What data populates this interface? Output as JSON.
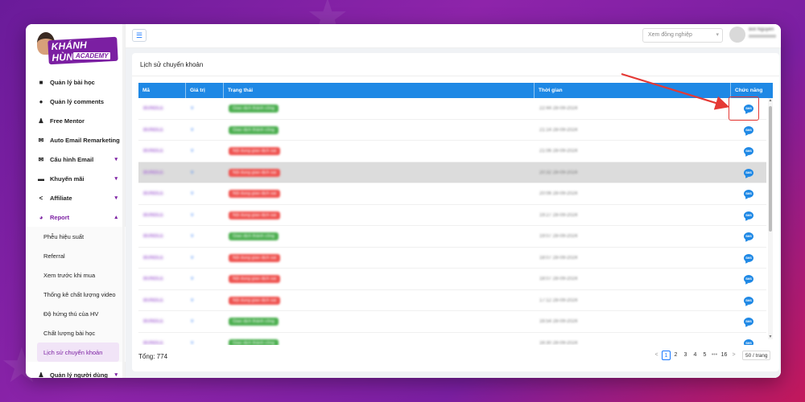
{
  "sidebar": {
    "logo": {
      "brand": "KHÁNH HÙNG",
      "sub": "ACADEMY"
    },
    "items": [
      {
        "label": "Quản lý bài học",
        "icon": "video-camera-icon",
        "glyph": "■"
      },
      {
        "label": "Quản lý comments",
        "icon": "comments-icon",
        "glyph": "●"
      },
      {
        "label": "Free Mentor",
        "icon": "user-icon",
        "glyph": "♟"
      },
      {
        "label": "Auto Email Remarketing",
        "icon": "email-icon",
        "glyph": "✉"
      },
      {
        "label": "Cấu hình Email",
        "icon": "mail-settings-icon",
        "glyph": "✉"
      },
      {
        "label": "Khuyến mãi",
        "icon": "ticket-icon",
        "glyph": "▬"
      },
      {
        "label": "Affiliate",
        "icon": "share-icon",
        "glyph": "<"
      },
      {
        "label": "Report",
        "icon": "pie-chart-icon",
        "glyph": "◕"
      }
    ],
    "report_sub": [
      "Phễu hiệu suất",
      "Referral",
      "Xem trước khi mua",
      "Thống kê chất lượng video",
      "Độ hứng thú của HV",
      "Chất lượng bài học",
      "Lịch sử chuyển khoản"
    ],
    "bottom_item": {
      "label": "Quản lý người dùng",
      "icon": "users-icon",
      "glyph": "♟"
    }
  },
  "topbar": {
    "search_placeholder": "Xem đồng nghiệp",
    "user_name": "Bot Nguyen"
  },
  "page": {
    "title": "Lịch sử chuyển khoản"
  },
  "table": {
    "columns": [
      "Mã",
      "Giá trị",
      "Trạng thái",
      "Thời gian",
      "Chức năng"
    ],
    "rows": [
      {
        "code": "BUNDLE",
        "value": "0",
        "status": "Giao dịch thành công",
        "status_color": "green",
        "time": "22:44 28-09-2024"
      },
      {
        "code": "BUNDLE",
        "value": "0",
        "status": "Giao dịch thành công",
        "status_color": "green",
        "time": "21:14 28-09-2024"
      },
      {
        "code": "BUNDLE",
        "value": "0",
        "status": "Nội dung giao dịch sai",
        "status_color": "red",
        "time": "21:06 28-09-2024"
      },
      {
        "code": "BUNDLE",
        "value": "0",
        "status": "Nội dung giao dịch sai",
        "status_color": "red",
        "time": "20:32 28-09-2024"
      },
      {
        "code": "BUNDLE",
        "value": "0",
        "status": "Nội dung giao dịch sai",
        "status_color": "red",
        "time": "20:06 28-09-2024"
      },
      {
        "code": "BUNDLE",
        "value": "0",
        "status": "Nội dung giao dịch sai",
        "status_color": "red",
        "time": "19:27 28-09-2024"
      },
      {
        "code": "BUNDLE",
        "value": "0",
        "status": "Giao dịch thành công",
        "status_color": "green",
        "time": "19:07 28-09-2024"
      },
      {
        "code": "BUNDLE",
        "value": "0",
        "status": "Nội dung giao dịch sai",
        "status_color": "red",
        "time": "18:07 28-09-2024"
      },
      {
        "code": "BUNDLE",
        "value": "0",
        "status": "Nội dung giao dịch sai",
        "status_color": "red",
        "time": "18:07 28-09-2024"
      },
      {
        "code": "BUNDLE",
        "value": "0",
        "status": "Nội dung giao dịch sai",
        "status_color": "red",
        "time": "17:12 28-09-2024"
      },
      {
        "code": "BUNDLE",
        "value": "0",
        "status": "Giao dịch thành công",
        "status_color": "green",
        "time": "16:54 28-09-2024"
      },
      {
        "code": "BUNDLE",
        "value": "0",
        "status": "Giao dịch thành công",
        "status_color": "green",
        "time": "16:30 28-09-2024"
      }
    ],
    "action_label": "SMS",
    "highlighted_row": 3
  },
  "footer": {
    "total": "Tổng: 774",
    "pages": [
      "1",
      "2",
      "3",
      "4",
      "5"
    ],
    "ellipsis": "•••",
    "last_page": "16",
    "prev": "<",
    "next": ">",
    "page_size": "50 / trang"
  },
  "colors": {
    "accent": "#7b1fa2",
    "table_header": "#1e88e5",
    "success": "#4caf50",
    "error": "#ef5350",
    "annotation": "#e53935"
  }
}
